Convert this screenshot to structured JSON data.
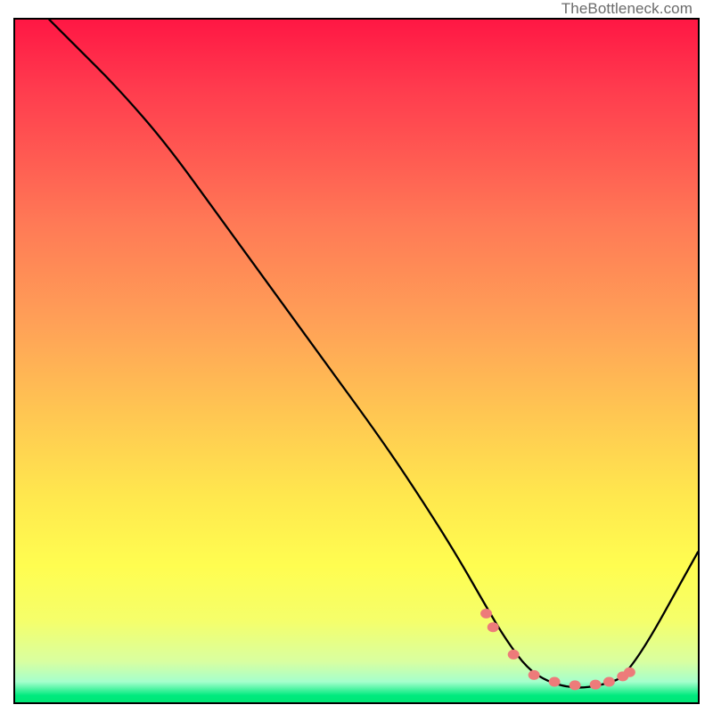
{
  "watermark": "TheBottleneck.com",
  "chart_data": {
    "type": "line",
    "title": "",
    "xlabel": "",
    "ylabel": "",
    "xlim": [
      0,
      100
    ],
    "ylim": [
      0,
      100
    ],
    "series": [
      {
        "name": "bottleneck-curve",
        "x": [
          5,
          9,
          15,
          22,
          30,
          38,
          46,
          54,
          60,
          65,
          69,
          72,
          75,
          78,
          82,
          86,
          90,
          100
        ],
        "values": [
          100,
          96,
          90,
          82,
          71,
          60,
          49,
          38,
          29,
          21,
          14,
          9,
          5,
          3,
          2,
          2.5,
          4,
          22
        ]
      }
    ],
    "highlight_points": {
      "name": "highlight-dots",
      "x": [
        69,
        70,
        73,
        76,
        79,
        82,
        85,
        87,
        89,
        90
      ],
      "values": [
        13,
        11,
        7,
        4,
        3,
        2.5,
        2.6,
        3,
        3.8,
        4.4
      ]
    }
  }
}
